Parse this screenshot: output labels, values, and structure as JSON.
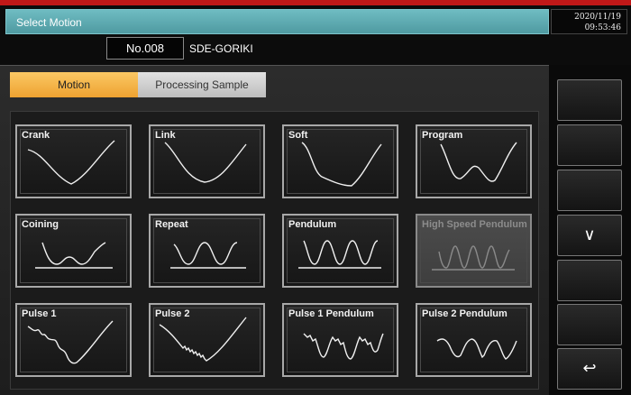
{
  "header": {
    "title": "Select Motion",
    "date": "2020/11/19",
    "time": "09:53:46"
  },
  "machine": {
    "number": "No.008",
    "name": "SDE-GORIKI"
  },
  "tabs": [
    {
      "label": "Motion",
      "active": true
    },
    {
      "label": "Processing Sample",
      "active": false
    }
  ],
  "motions": [
    {
      "label": "Crank",
      "enabled": true
    },
    {
      "label": "Link",
      "enabled": true
    },
    {
      "label": "Soft",
      "enabled": true
    },
    {
      "label": "Program",
      "enabled": true
    },
    {
      "label": "Coining",
      "enabled": true
    },
    {
      "label": "Repeat",
      "enabled": true
    },
    {
      "label": "Pendulum",
      "enabled": true
    },
    {
      "label": "High Speed Pendulum",
      "enabled": false
    },
    {
      "label": "Pulse 1",
      "enabled": true
    },
    {
      "label": "Pulse 2",
      "enabled": true
    },
    {
      "label": "Pulse 1 Pendulum",
      "enabled": true
    },
    {
      "label": "Pulse 2 Pendulum",
      "enabled": true
    }
  ],
  "side_buttons": [
    {
      "icon": "blank",
      "glyph": ""
    },
    {
      "icon": "blank",
      "glyph": ""
    },
    {
      "icon": "blank",
      "glyph": ""
    },
    {
      "icon": "chevron-down-icon",
      "glyph": "∨"
    },
    {
      "icon": "blank",
      "glyph": ""
    },
    {
      "icon": "blank",
      "glyph": ""
    },
    {
      "icon": "return-icon",
      "glyph": "↩"
    }
  ],
  "colors": {
    "title_bar": "#5aa8ae",
    "active_tab": "#f5b446",
    "alert_line": "#c01818"
  }
}
